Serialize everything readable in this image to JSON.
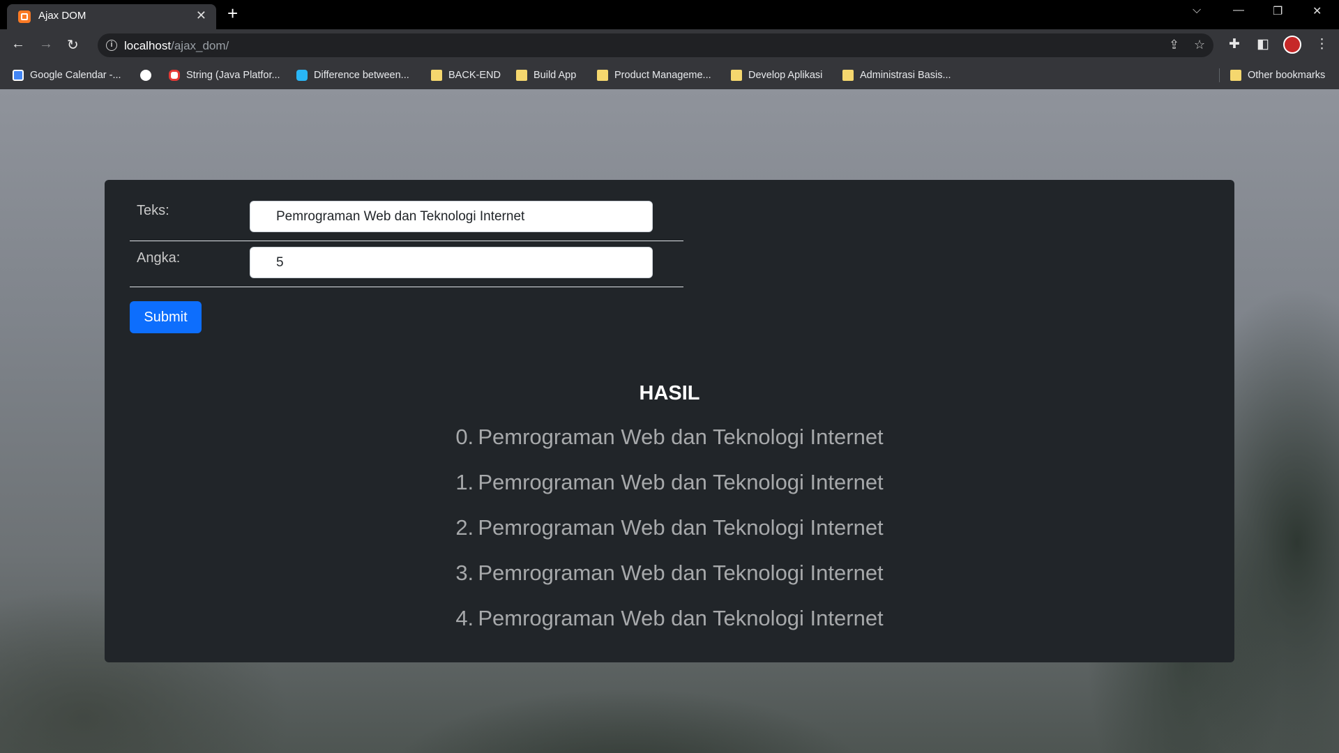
{
  "browser": {
    "tab_title": "Ajax DOM",
    "url_host": "localhost",
    "url_path": "/ajax_dom/",
    "bookmarks": [
      {
        "label": "Google Calendar -...",
        "icon": "calendar-icon"
      },
      {
        "label": "",
        "icon": "globe-icon"
      },
      {
        "label": "String (Java Platfor...",
        "icon": "oracle-icon"
      },
      {
        "label": "Difference between...",
        "icon": "site-icon"
      },
      {
        "label": "BACK-END",
        "icon": "folder-icon"
      },
      {
        "label": "Build App",
        "icon": "folder-icon"
      },
      {
        "label": "Product Manageme...",
        "icon": "folder-icon"
      },
      {
        "label": "Develop Aplikasi",
        "icon": "folder-icon"
      },
      {
        "label": "Administrasi Basis...",
        "icon": "folder-icon"
      }
    ],
    "other_bookmarks": "Other bookmarks"
  },
  "form": {
    "teks_label": "Teks:",
    "teks_value": "Pemrograman Web dan Teknologi Internet",
    "angka_label": "Angka:",
    "angka_value": "5",
    "submit_label": "Submit"
  },
  "result": {
    "title": "HASIL",
    "items": [
      {
        "num": "0.",
        "text": "Pemrograman Web dan Teknologi Internet"
      },
      {
        "num": "1.",
        "text": "Pemrograman Web dan Teknologi Internet"
      },
      {
        "num": "2.",
        "text": "Pemrograman Web dan Teknologi Internet"
      },
      {
        "num": "3.",
        "text": "Pemrograman Web dan Teknologi Internet"
      },
      {
        "num": "4.",
        "text": "Pemrograman Web dan Teknologi Internet"
      }
    ]
  },
  "colors": {
    "primary": "#0d6efd",
    "card_bg": "#212529",
    "result_text": "#a7a9ab"
  }
}
